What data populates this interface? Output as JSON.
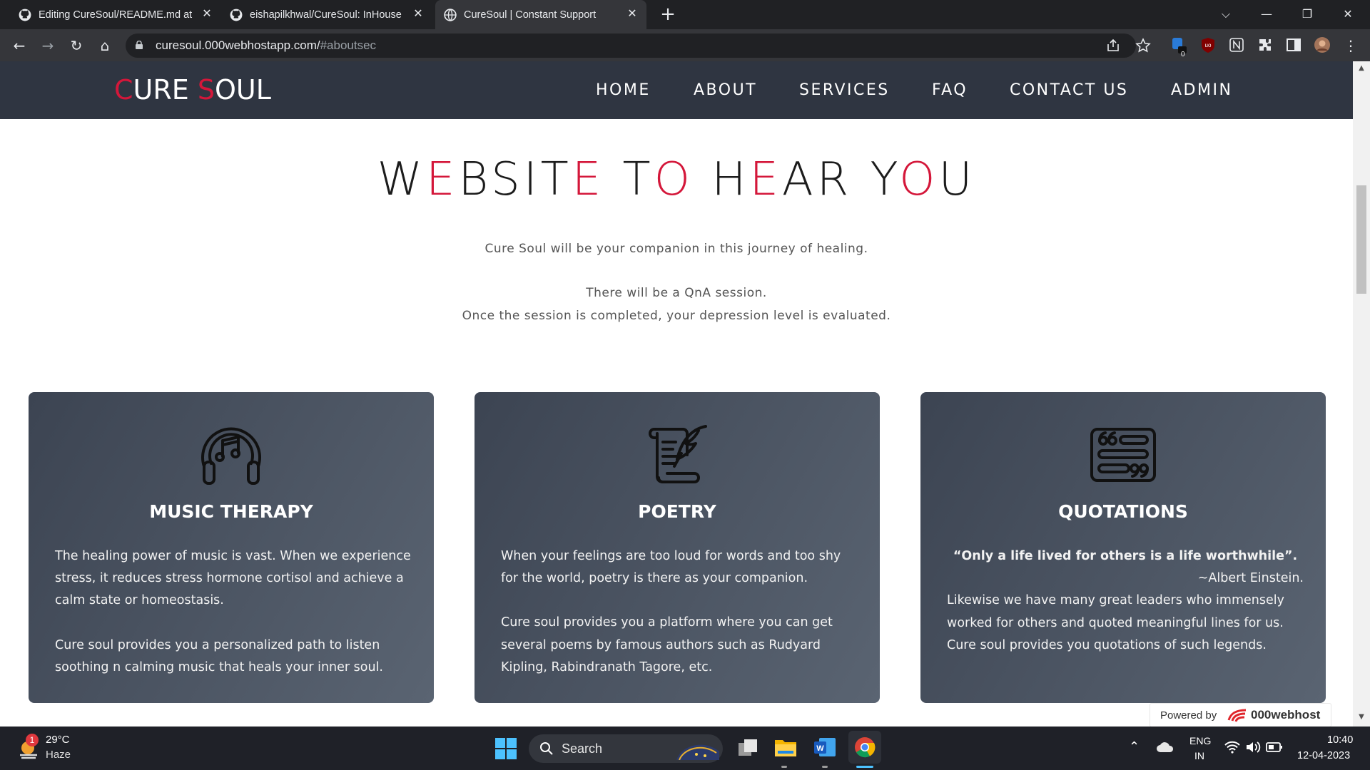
{
  "browser": {
    "tabs": [
      {
        "title": "Editing CureSoul/README.md at",
        "active": false
      },
      {
        "title": "eishapilkhwal/CureSoul: InHouse",
        "active": false
      },
      {
        "title": "CureSoul | Constant Support",
        "active": true
      }
    ],
    "url_host": "curesoul.000webhostapp.com/",
    "url_hash": "#aboutsec",
    "ext_badge": "0"
  },
  "site": {
    "logo_c": "C",
    "logo_ure": "URE ",
    "logo_s": "S",
    "logo_oul": "OUL",
    "nav": [
      "HOME",
      "ABOUT",
      "SERVICES",
      "FAQ",
      "CONTACT US",
      "ADMIN"
    ]
  },
  "headline": {
    "parts": [
      "W",
      "E",
      "BSIT",
      "E",
      " T",
      "O",
      " H",
      "E",
      "AR Y",
      "O",
      "U"
    ]
  },
  "intro": {
    "line1": "Cure Soul will be your companion in this journey of healing.",
    "line2": "There will be a QnA session.",
    "line3": "Once the session is completed, your depression level is evaluated."
  },
  "cards": [
    {
      "icon": "headphones-music-icon",
      "title": "MUSIC THERAPY",
      "p1": "The healing power of music is vast. When we experience stress, it reduces stress hormone cortisol and achieve a calm state or homeostasis.",
      "p2": "Cure soul provides you a personalized path to listen soothing n calming music that heals your inner soul."
    },
    {
      "icon": "scroll-quill-icon",
      "title": "POETRY",
      "p1": "When your feelings are too loud for words and too shy for the world, poetry is there as your companion.",
      "p2": "Cure soul provides you a platform where you can get several poems by famous authors such as Rudyard Kipling, Rabindranath Tagore, etc."
    },
    {
      "icon": "quote-board-icon",
      "title": "QUOTATIONS",
      "quote": "“Only a life lived for others is a life worthwhile”.",
      "author": "~Albert Einstein.",
      "p1": "Likewise we have many great leaders who immensely worked for others and quoted meaningful lines for us.",
      "p2": "Cure soul provides you quotations of such legends."
    }
  ],
  "powered": {
    "label": "Powered by",
    "brand": "000webhost"
  },
  "taskbar": {
    "weather_temp": "29°C",
    "weather_desc": "Haze",
    "weather_badge": "1",
    "search_label": "Search",
    "lang1": "ENG",
    "lang2": "IN",
    "time": "10:40",
    "date": "12-04-2023"
  }
}
